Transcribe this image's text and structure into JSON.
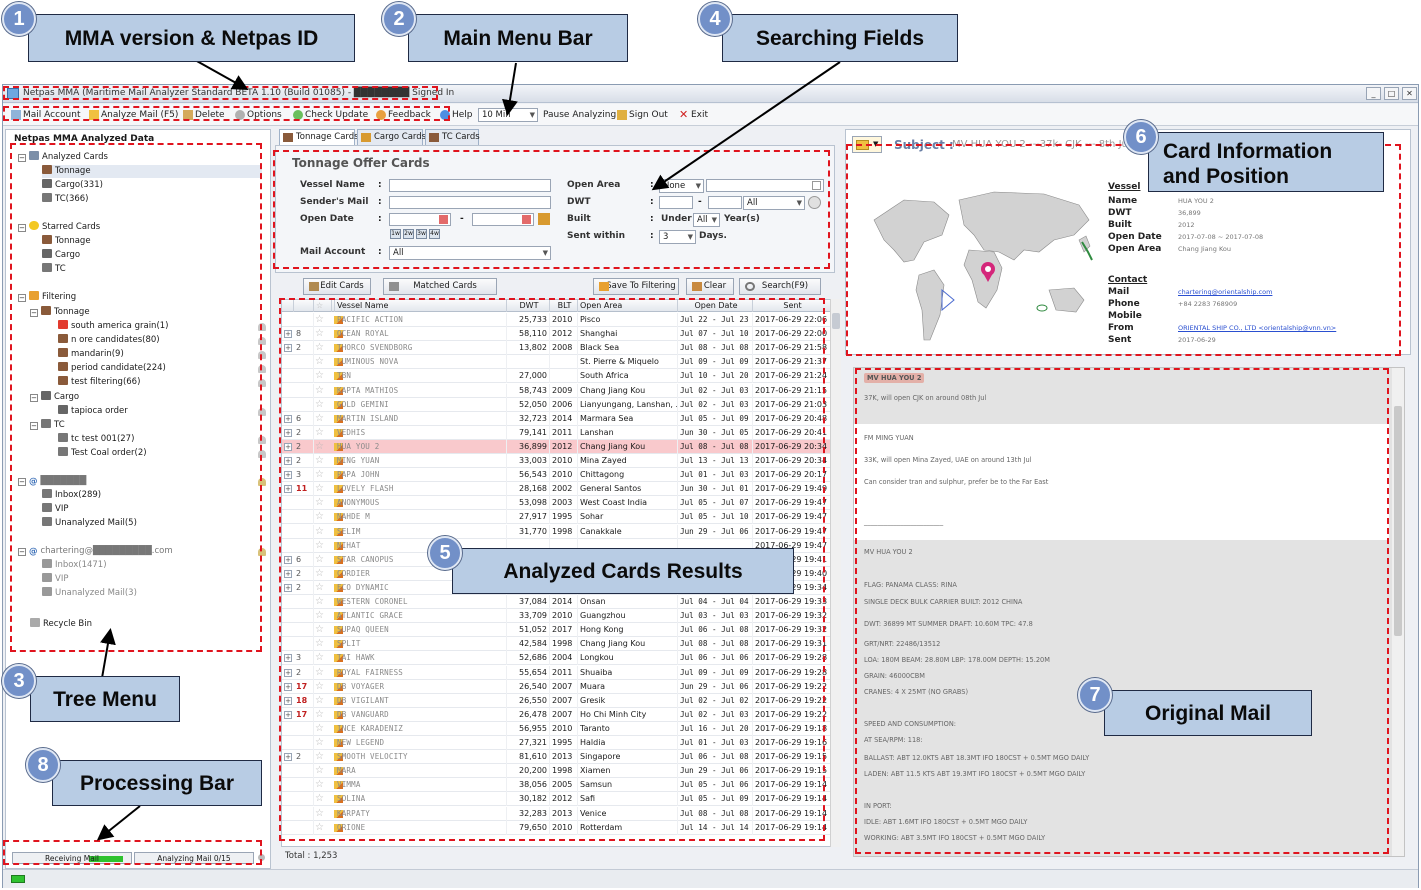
{
  "window": {
    "title": "Netpas MMA (Maritime Mail Analyzer Standard BETA 1.10 (Build 01085) - ████████ Signed In",
    "controls": [
      "_",
      "□",
      "✕"
    ]
  },
  "menu": {
    "mail_account": "Mail Account",
    "analyze_mail": "Analyze Mail (F5)",
    "delete": "Delete",
    "options": "Options",
    "check_update": "Check Update",
    "feedback": "Feedback",
    "help": "Help",
    "interval": "10 Min",
    "pause": "Pause Analyzing",
    "sign_out": "Sign Out",
    "exit": "Exit"
  },
  "tree": {
    "title": "Netpas MMA Analyzed Data",
    "analyzed": {
      "label": "Analyzed Cards",
      "tonnage": "Tonnage",
      "cargo": "Cargo(331)",
      "tc": "TC(366)"
    },
    "starred": {
      "label": "Starred Cards",
      "tonnage": "Tonnage",
      "cargo": "Cargo",
      "tc": "TC"
    },
    "filtering": {
      "label": "Filtering",
      "tonnage": "Tonnage",
      "tonnage_items": [
        "south america grain(1)",
        "n ore candidates(80)",
        "mandarin(9)",
        "period candidate(224)",
        "test filtering(66)"
      ],
      "cargo": "Cargo",
      "cargo_items": [
        "tapioca order"
      ],
      "tc": "TC",
      "tc_items": [
        "tc test 001(27)",
        "Test Coal order(2)"
      ]
    },
    "account1": {
      "name": "███████",
      "inbox": "Inbox(289)",
      "vip": "VIP",
      "unanalyzed": "Unanalyzed Mail(5)"
    },
    "account2": {
      "name": "chartering@█████████.com",
      "inbox": "Inbox(1471)",
      "vip": "VIP",
      "unanalyzed": "Unanalyzed Mail(3)"
    },
    "recycle": "Recycle Bin"
  },
  "tabs": [
    "Tonnage Cards",
    "Cargo Cards",
    "TC Cards"
  ],
  "search": {
    "title": "Tonnage Offer Cards",
    "vessel_name": "Vessel Name",
    "senders_mail": "Sender's Mail",
    "open_date": "Open Date",
    "mail_account": "Mail Account",
    "mail_account_value": "All",
    "date_buttons": [
      "1w",
      "2w",
      "3w",
      "4w"
    ],
    "open_area": "Open Area",
    "open_area_value": "None",
    "dwt": "DWT",
    "dwt_value": "All",
    "built": "Built",
    "under": "Under",
    "built_value": "All",
    "years": "Year(s)",
    "sent_within": "Sent within",
    "sent_value": "3",
    "days": "Days."
  },
  "actions": {
    "edit": "Edit Cards",
    "matched": "Matched Cards",
    "save_filter": "Save To Filtering",
    "clear": "Clear",
    "search": "Search(F9)"
  },
  "grid": {
    "columns": [
      "",
      "",
      "",
      "Vessel Name",
      "DWT",
      "BLT",
      "Open Area",
      "Open Date",
      "Sent"
    ],
    "rows": [
      [
        "",
        "",
        "PACIFIC ACTION",
        "25,733",
        "2010",
        "Pisco",
        "Jul 22 - Jul 23",
        "2017-06-29 22:06"
      ],
      [
        "+",
        "8",
        "OCEAN ROYAL",
        "58,110",
        "2012",
        "Shanghai",
        "Jul 07 - Jul 10",
        "2017-06-29 22:00"
      ],
      [
        "+",
        "2",
        "THORCO SVENDBORG",
        "13,802",
        "2008",
        "Black Sea",
        "Jul 08 - Jul 08",
        "2017-06-29 21:58"
      ],
      [
        "",
        "",
        "LUMINOUS NOVA",
        "",
        "",
        "St. Pierre & Miquelo",
        "Jul 09 - Jul 09",
        "2017-06-29 21:37"
      ],
      [
        "",
        "",
        "TBN",
        "27,000",
        "",
        "South Africa",
        "Jul 10 - Jul 20",
        "2017-06-29 21:24"
      ],
      [
        "",
        "",
        "KAPTA MATHIOS",
        "58,743",
        "2009",
        "Chang Jiang Kou",
        "Jul 02 - Jul 03",
        "2017-06-29 21:15"
      ],
      [
        "",
        "",
        "GOLD GEMINI",
        "52,050",
        "2006",
        "Lianyungang, Lanshan, ...",
        "Jul 02 - Jul 03",
        "2017-06-29 21:03"
      ],
      [
        "+",
        "6",
        "MARTIN ISLAND",
        "32,723",
        "2014",
        "Marmara Sea",
        "Jul 05 - Jul 09",
        "2017-06-29 20:48"
      ],
      [
        "+",
        "2",
        "VEDHIS",
        "79,141",
        "2011",
        "Lanshan",
        "Jun 30 - Jul 05",
        "2017-06-29 20:41"
      ],
      [
        "+",
        "2",
        "HUA YOU 2",
        "36,899",
        "2012",
        "Chang Jiang Kou",
        "Jul 08 - Jul 08",
        "2017-06-29 20:34"
      ],
      [
        "+",
        "2",
        "MING YUAN",
        "33,003",
        "2010",
        "Mina Zayed",
        "Jul 13 - Jul 13",
        "2017-06-29 20:34"
      ],
      [
        "+",
        "3",
        "PAPA JOHN",
        "56,543",
        "2010",
        "Chittagong",
        "Jul 01 - Jul 03",
        "2017-06-29 20:17"
      ],
      [
        "+",
        "11",
        "LOVELY FLASH",
        "28,168",
        "2002",
        "General Santos",
        "Jun 30 - Jul 01",
        "2017-06-29 19:49"
      ],
      [
        "",
        "",
        "ANONYMOUS",
        "53,098",
        "2003",
        "West Coast India",
        "Jul 05 - Jul 07",
        "2017-06-29 19:47"
      ],
      [
        "",
        "",
        "NAHDE M",
        "27,917",
        "1995",
        "Sohar",
        "Jul 05 - Jul 10",
        "2017-06-29 19:47"
      ],
      [
        "",
        "",
        "SELIM",
        "31,770",
        "1998",
        "Canakkale",
        "Jun 29 - Jul 06",
        "2017-06-29 19:47"
      ],
      [
        "",
        "",
        "NIHAT",
        "",
        "",
        "",
        "",
        "2017-06-29 19:47"
      ],
      [
        "+",
        "6",
        "STAR CANOPUS",
        "",
        "",
        "",
        "",
        "2017-06-29 19:41"
      ],
      [
        "+",
        "2",
        "CORDIER",
        "",
        "",
        "",
        "",
        "2017-06-29 19:40"
      ],
      [
        "+",
        "2",
        "ECO DYNAMIC",
        "",
        "",
        "",
        "",
        "2017-06-29 19:34"
      ],
      [
        "",
        "",
        "WESTERN CORONEL",
        "37,084",
        "2014",
        "Onsan",
        "Jul 04 - Jul 04",
        "2017-06-29 19:33"
      ],
      [
        "",
        "",
        "ATLANTIC GRACE",
        "33,709",
        "2010",
        "Guangzhou",
        "Jul 03 - Jul 03",
        "2017-06-29 19:32"
      ],
      [
        "",
        "",
        "SUPAQ QUEEN",
        "51,052",
        "2017",
        "Hong Kong",
        "Jul 06 - Jul 08",
        "2017-06-29 19:32"
      ],
      [
        "",
        "",
        "SPLIT",
        "42,584",
        "1998",
        "Chang Jiang Kou",
        "Jul 08 - Jul 08",
        "2017-06-29 19:31"
      ],
      [
        "+",
        "3",
        "TAI HAWK",
        "52,686",
        "2004",
        "Longkou",
        "Jul 06 - Jul 06",
        "2017-06-29 19:28"
      ],
      [
        "+",
        "2",
        "ROYAL FAIRNESS",
        "55,654",
        "2011",
        "Shuaiba",
        "Jul 09 - Jul 09",
        "2017-06-29 19:28"
      ],
      [
        "+",
        "17",
        "DB VOYAGER",
        "26,540",
        "2007",
        "Muara",
        "Jun 29 - Jul 06",
        "2017-06-29 19:22"
      ],
      [
        "+",
        "18",
        "DB VIGILANT",
        "26,550",
        "2007",
        "Gresik",
        "Jul 02 - Jul 02",
        "2017-06-29 19:22"
      ],
      [
        "+",
        "17",
        "DB VANGUARD",
        "26,478",
        "2007",
        "Ho Chi Minh City",
        "Jul 02 - Jul 03",
        "2017-06-29 19:22"
      ],
      [
        "",
        "",
        "INCE KARADENIZ",
        "56,955",
        "2010",
        "Taranto",
        "Jul 16 - Jul 20",
        "2017-06-29 19:18"
      ],
      [
        "",
        "",
        "NEW LEGEND",
        "27,321",
        "1995",
        "Haldia",
        "Jul 01 - Jul 03",
        "2017-06-29 19:16"
      ],
      [
        "+",
        "2",
        "SMOOTH VELOCITY",
        "81,610",
        "2013",
        "Singapore",
        "Jul 06 - Jul 08",
        "2017-06-29 19:15"
      ],
      [
        "",
        "",
        "MARA",
        "20,200",
        "1998",
        "Xiamen",
        "Jun 29 - Jul 06",
        "2017-06-29 19:15"
      ],
      [
        "",
        "",
        "VIMMA",
        "38,056",
        "2005",
        "Samsun",
        "Jul 05 - Jul 06",
        "2017-06-29 19:14"
      ],
      [
        "",
        "",
        "SOLINA",
        "30,182",
        "2012",
        "Safi",
        "Jul 05 - Jul 09",
        "2017-06-29 19:14"
      ],
      [
        "",
        "",
        "KARPATY",
        "32,283",
        "2013",
        "Venice",
        "Jul 08 - Jul 08",
        "2017-06-29 19:14"
      ],
      [
        "",
        "",
        "ORIONE",
        "79,650",
        "2010",
        "Rotterdam",
        "Jul 14 - Jul 14",
        "2017-06-29 19:14"
      ]
    ],
    "total": "Total : 1,253"
  },
  "card_info": {
    "subject_label": "Subject :",
    "subject": "MV HUA YOU 2 ---37k- CJK --- 8th Jul",
    "vessel_heading": "Vessel",
    "name_label": "Name",
    "name": "HUA YOU 2",
    "dwt_label": "DWT",
    "dwt": "36,899",
    "built_label": "Built",
    "built": "2012",
    "open_date_label": "Open Date",
    "open_date": "2017-07-08 ~ 2017-07-08",
    "open_area_label": "Open Area",
    "open_area": "Chang Jiang Kou",
    "contact_heading": "Contact",
    "mail_label": "Mail",
    "mail": "chartering@orientalship.com",
    "phone_label": "Phone",
    "phone": "+84 2283 768909",
    "mobile_label": "Mobile",
    "mobile": "",
    "from_label": "From",
    "from": "ORIENTAL SHIP CO., LTD <orientalship@vnn.vn>",
    "sent_label": "Sent",
    "sent": "2017-06-29"
  },
  "mail": {
    "lines": [
      "MV HUA YOU 2",
      "37K, will open CJK on around 08th Jul",
      "FM MING YUAN",
      "33K, will open Mina Zayed, UAE on around 13th Jul",
      "Can consider tran and sulphur, prefer be to the Far East",
      "________________________",
      "MV HUA YOU 2",
      "FLAG: PANAMA CLASS: RINA",
      "SINGLE DECK BULK CARRIER BUILT: 2012 CHINA",
      "DWT: 36899 MT SUMMER DRAFT: 10.60M TPC: 47.8",
      "GRT/NRT: 22486/13512",
      "LOA: 180M BEAM: 28.80M LBP: 178.00M DEPTH: 15.20M",
      "GRAIN: 46000CBM",
      "CRANES: 4 X 25MT (NO GRABS)",
      "SPEED AND CONSUMPTION:",
      "AT SEA/RPM: 118:",
      "BALLAST: ABT 12.0KTS ABT 18.3MT IFO 180CST + 0.5MT MGO DAILY",
      "LADEN: ABT 11.5 KTS ABT 19.3MT IFO 180CST + 0.5MT MGO DAILY",
      "IN PORT:",
      "IDLE: ABT 1.6MT IFO 180CST + 0.5MT MGO DAILY",
      "WORKING: ABT 3.5MT IFO 180CST + 0.5MT MGO DAILY"
    ]
  },
  "status": {
    "receiving": "Receiving Mail",
    "analyzing": "Analyzing Mail 0/15"
  },
  "annotations": {
    "c1": {
      "num": "1",
      "text": "MMA version & Netpas ID"
    },
    "c2": {
      "num": "2",
      "text": "Main Menu Bar"
    },
    "c3": {
      "num": "3",
      "text": "Tree Menu"
    },
    "c4": {
      "num": "4",
      "text": "Searching Fields"
    },
    "c5": {
      "num": "5",
      "text": "Analyzed Cards Results"
    },
    "c6": {
      "num": "6",
      "text": "Card Information and Position"
    },
    "c7": {
      "num": "7",
      "text": "Original Mail"
    },
    "c8": {
      "num": "8",
      "text": "Processing Bar"
    }
  },
  "colors": {
    "accent": "#7290c8",
    "callout_bg": "#b8cce4",
    "highlight": "#e0141e",
    "selected_row": "#f9c9cc"
  }
}
